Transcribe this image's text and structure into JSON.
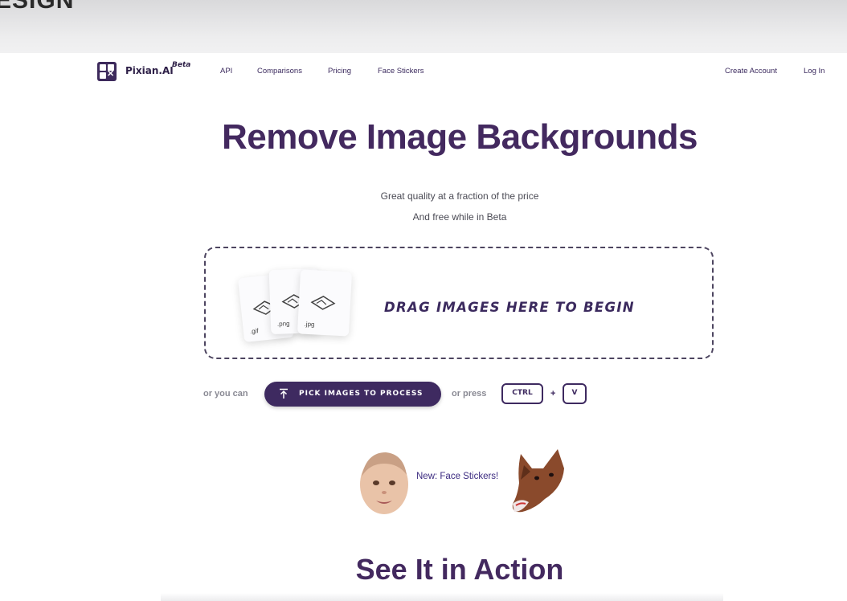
{
  "header_strip": {
    "clipped_text": "ESIGN"
  },
  "brand": {
    "name": "Pixian.AI",
    "badge": "Beta"
  },
  "nav": {
    "items": [
      "API",
      "Comparisons",
      "Pricing",
      "Face Stickers"
    ],
    "create_account": "Create Account",
    "login": "Log In"
  },
  "hero": {
    "title": "Remove Image Backgrounds",
    "subtitle1": "Great quality at a fraction of the price",
    "subtitle2": "And free while in Beta"
  },
  "dropzone": {
    "label": "DRAG IMAGES HERE TO BEGIN",
    "file_types": [
      ".gif",
      ".png",
      ".jpg"
    ]
  },
  "pick": {
    "prefix": "or you can",
    "button_label": "PICK IMAGES TO PROCESS",
    "press_prefix": "or press",
    "key1": "CTRL",
    "plus": "+",
    "key2": "V"
  },
  "face_stickers": {
    "link_label": "New: Face Stickers!"
  },
  "section": {
    "title": "See It in Action"
  },
  "colors": {
    "brand": "#3e2a60",
    "text": "#43295f"
  }
}
